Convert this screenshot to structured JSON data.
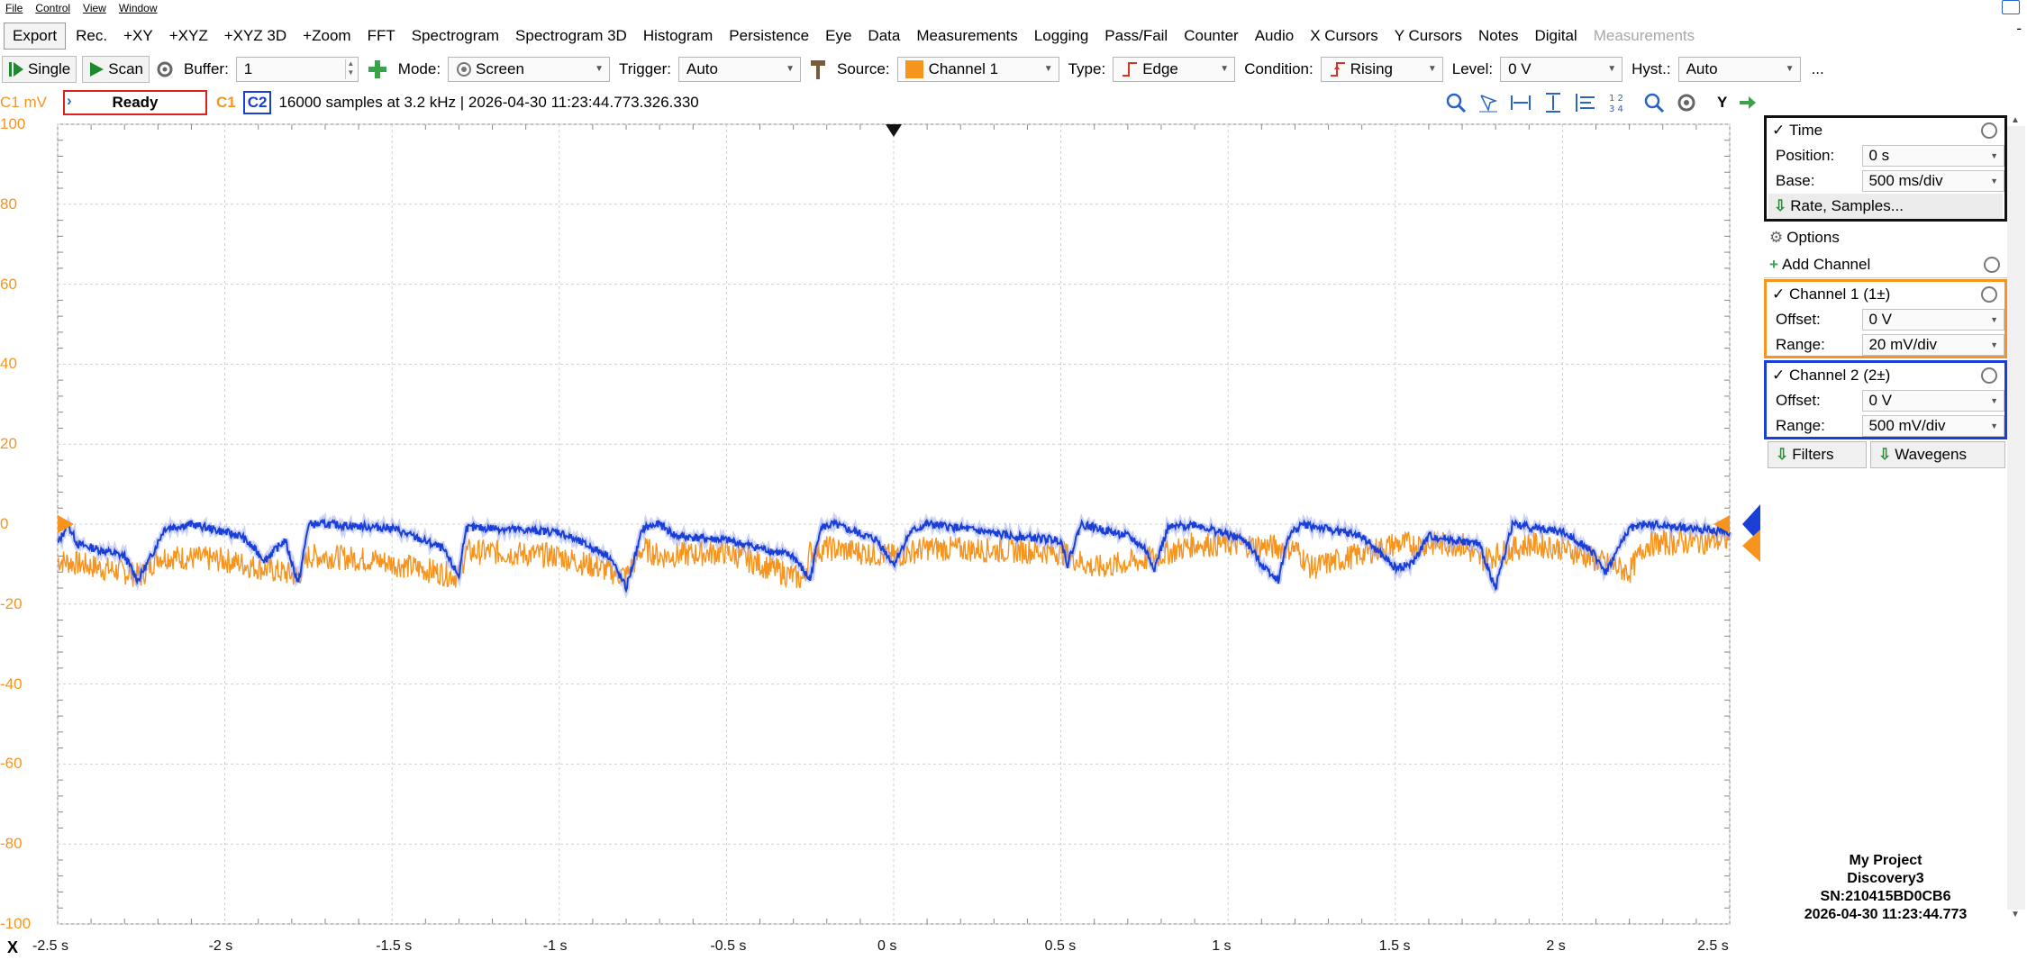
{
  "menu": [
    "File",
    "Control",
    "View",
    "Window"
  ],
  "tools": [
    "Export",
    "Rec.",
    "+XY",
    "+XYZ",
    "+XYZ 3D",
    "+Zoom",
    "FFT",
    "Spectrogram",
    "Spectrogram 3D",
    "Histogram",
    "Persistence",
    "Eye",
    "Data",
    "Measurements",
    "Logging",
    "Pass/Fail",
    "Counter",
    "Audio",
    "X Cursors",
    "Y Cursors",
    "Notes",
    "Digital"
  ],
  "tools_disabled": "Measurements",
  "tools_overflow": "-",
  "control": {
    "single": "Single",
    "scan": "Scan",
    "buffer_label": "Buffer:",
    "buffer_value": "1",
    "mode_label": "Mode:",
    "mode_value": "Screen",
    "trigger_label": "Trigger:",
    "trigger_value": "Auto",
    "source_label": "Source:",
    "source_value": "Channel 1",
    "type_label": "Type:",
    "type_value": "Edge",
    "condition_label": "Condition:",
    "condition_value": "Rising",
    "level_label": "Level:",
    "level_value": "0 V",
    "hyst_label": "Hyst.:",
    "hyst_value": "Auto",
    "overflow": "..."
  },
  "status": {
    "yunit": "C1 mV",
    "state": "Ready",
    "c1": "C1",
    "c2": "C2",
    "info": "16000 samples at 3.2 kHz  | 2026-04-30 11:23:44.773.326.330",
    "y_button": "Y"
  },
  "colors": {
    "ch1": "#f7941d",
    "ch2": "#1a3fd6",
    "ready_border": "#e02020"
  },
  "chart_data": {
    "type": "line",
    "title": "",
    "xlabel": "",
    "ylabel": "C1 mV",
    "xlim": [
      -2.5,
      2.5
    ],
    "ylim": [
      -100,
      100
    ],
    "y_ticks": [
      "100",
      "80",
      "60",
      "40",
      "20",
      "0",
      "-20",
      "-40",
      "-60",
      "-80",
      "-100"
    ],
    "x_ticks": [
      "-2.5 s",
      "-2 s",
      "-1.5 s",
      "-1 s",
      "-0.5 s",
      "0 s",
      "0.5 s",
      "1 s",
      "1.5 s",
      "2 s",
      "2.5 s"
    ],
    "x_axis_label": "X",
    "grid": true,
    "series": [
      {
        "name": "C1",
        "color": "#f7941d",
        "x": [
          -2.5,
          -2.3,
          -2.25,
          -2.2,
          -2.0,
          -1.78,
          -1.75,
          -1.7,
          -1.55,
          -1.3,
          -1.28,
          -1.2,
          -1.0,
          -0.8,
          -0.75,
          -0.7,
          -0.5,
          -0.27,
          -0.25,
          -0.2,
          0.0,
          0.1,
          0.5,
          0.6,
          0.75,
          0.9,
          1.0,
          1.2,
          1.25,
          1.5,
          1.7,
          1.75,
          1.9,
          2.0,
          2.2,
          2.25,
          2.5
        ],
        "values": [
          -9,
          -12,
          -13,
          -8,
          -9,
          -13,
          -8,
          -8,
          -9,
          -13,
          -7,
          -7,
          -8,
          -13,
          -6,
          -8,
          -7,
          -14,
          -7,
          -6,
          -8,
          -6,
          -7,
          -11,
          -9,
          -5,
          -5,
          -6,
          -11,
          -5,
          -5,
          -9,
          -5,
          -6,
          -12,
          -5,
          -4
        ]
      },
      {
        "name": "C2",
        "color": "#1a3fd6",
        "x": [
          -2.5,
          -2.47,
          -2.44,
          -2.3,
          -2.26,
          -2.22,
          -2.18,
          -2.1,
          -1.95,
          -1.88,
          -1.82,
          -1.78,
          -1.75,
          -1.7,
          -1.5,
          -1.35,
          -1.3,
          -1.28,
          -1.2,
          -1.0,
          -0.85,
          -0.8,
          -0.75,
          -0.7,
          -0.65,
          -0.5,
          -0.3,
          -0.25,
          -0.22,
          -0.18,
          -0.05,
          0.0,
          0.05,
          0.1,
          0.2,
          0.35,
          0.5,
          0.52,
          0.56,
          0.7,
          0.75,
          0.78,
          0.82,
          0.9,
          1.05,
          1.1,
          1.15,
          1.18,
          1.22,
          1.4,
          1.5,
          1.55,
          1.6,
          1.75,
          1.8,
          1.85,
          2.0,
          2.08,
          2.13,
          2.2,
          2.25,
          2.5
        ],
        "values": [
          -5,
          0,
          -5,
          -8,
          -14,
          -8,
          -1,
          0,
          -3,
          -9,
          -4,
          -15,
          0,
          0,
          -1,
          -6,
          -13,
          -1,
          -1,
          -2,
          -8,
          -16,
          -1,
          0,
          -3,
          -4,
          -8,
          -14,
          -1,
          0,
          -4,
          -10,
          -2,
          0,
          -1,
          -3,
          -4,
          -10,
          0,
          -3,
          -6,
          -11,
          -1,
          0,
          -4,
          -10,
          -14,
          -3,
          0,
          -3,
          -11,
          -10,
          -3,
          -5,
          -16,
          0,
          -2,
          -6,
          -12,
          -1,
          0,
          -2
        ]
      }
    ]
  },
  "panel": {
    "time": {
      "title": "Time",
      "position_label": "Position:",
      "position": "0 s",
      "base_label": "Base:",
      "base": "500 ms/div",
      "rate": "Rate, Samples..."
    },
    "options": "Options",
    "add_channel": "Add Channel",
    "ch1": {
      "title": "Channel 1 (1±)",
      "offset_label": "Offset:",
      "offset": "0 V",
      "range_label": "Range:",
      "range": "20 mV/div"
    },
    "ch2": {
      "title": "Channel 2 (2±)",
      "offset_label": "Offset:",
      "offset": "0 V",
      "range_label": "Range:",
      "range": "500 mV/div"
    },
    "filters": "Filters",
    "wavegens": "Wavegens",
    "project": {
      "name": "My Project",
      "device": "Discovery3",
      "sn": "SN:210415BD0CB6",
      "timestamp": "2026-04-30 11:23:44.773"
    }
  }
}
